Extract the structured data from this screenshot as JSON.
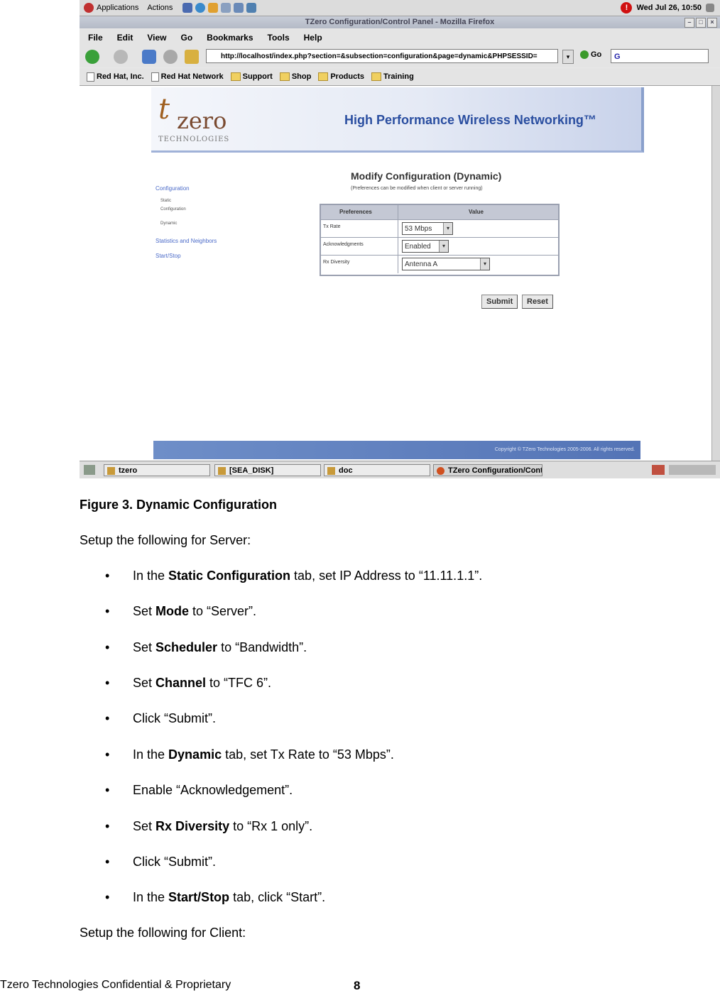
{
  "screenshot": {
    "panel": {
      "applications": "Applications",
      "actions": "Actions",
      "clock": "Wed Jul 26, 10:50"
    },
    "window_title": "TZero Configuration/Control Panel - Mozilla Firefox",
    "menu": [
      "File",
      "Edit",
      "View",
      "Go",
      "Bookmarks",
      "Tools",
      "Help"
    ],
    "url": "http://localhost/index.php?section=&subsection=configuration&page=dynamic&PHPSESSID=",
    "go_label": "Go",
    "search_value": "G",
    "bookmarks": [
      "Red Hat, Inc.",
      "Red Hat Network",
      "Support",
      "Shop",
      "Products",
      "Training"
    ],
    "page": {
      "logo_t": "t",
      "logo_zero": "zero",
      "logo_tech": "TECHNOLOGIES",
      "banner_title": "High Performance Wireless Networking™",
      "nav": {
        "configuration": "Configuration",
        "static": "Static",
        "static_sub": "Configuration",
        "dynamic": "Dynamic",
        "stats": "Statistics and Neighbors",
        "startstop": "Start/Stop"
      },
      "title": "Modify Configuration (Dynamic)",
      "subtitle": "(Preferences can be modified when client or server running)",
      "table": {
        "col_pref": "Preferences",
        "col_value": "Value",
        "rows": [
          {
            "label": "Tx Rate",
            "value": "53 Mbps"
          },
          {
            "label": "Acknowledgments",
            "value": "Enabled"
          },
          {
            "label": "Rx Diversity",
            "value": "Antenna A"
          }
        ]
      },
      "submit": "Submit",
      "reset": "Reset",
      "copyright": "Copyright © TZero Technologies 2005-2006. All rights reserved."
    },
    "taskbar": [
      "tzero",
      "[SEA_DISK]",
      "doc",
      "TZero Configuration/Cont"
    ]
  },
  "doc": {
    "caption": "Figure 3. Dynamic Configuration",
    "server_intro": "Setup the following for Server:",
    "bullet_char": "•",
    "bullets": [
      {
        "pre": "In the ",
        "bold": "Static Configuration",
        "post": " tab, set IP Address to “11.11.1.1”."
      },
      {
        "pre": "Set ",
        "bold": "Mode",
        "post": " to “Server”."
      },
      {
        "pre": "Set ",
        "bold": "Scheduler",
        "post": " to “Bandwidth”."
      },
      {
        "pre": "Set ",
        "bold": "Channel",
        "post": " to “TFC 6”."
      },
      {
        "pre": "Click “Submit”.",
        "bold": "",
        "post": ""
      },
      {
        "pre": "In the ",
        "bold": "Dynamic",
        "post": " tab, set Tx Rate to “53 Mbps”."
      },
      {
        "pre": "Enable “Acknowledgement”.",
        "bold": "",
        "post": ""
      },
      {
        "pre": "Set ",
        "bold": "Rx Diversity",
        "post": " to “Rx 1 only”."
      },
      {
        "pre": "Click “Submit”.",
        "bold": "",
        "post": ""
      },
      {
        "pre": "In the ",
        "bold": "Start/Stop",
        "post": " tab, click “Start”."
      }
    ],
    "client_intro": "Setup the following for Client:",
    "footer_left": "Tzero Technologies Confidential & Proprietary",
    "page_number": "8"
  }
}
